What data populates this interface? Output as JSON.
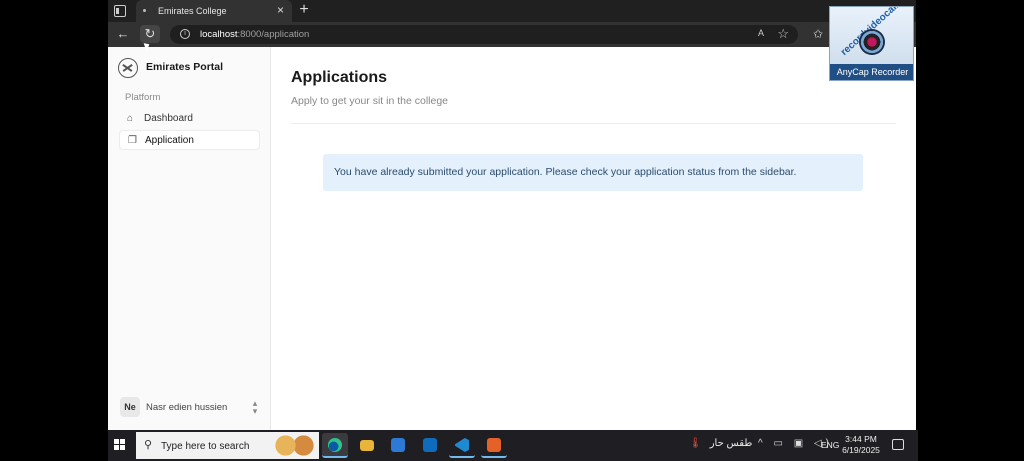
{
  "browser": {
    "tab_title": "Emirates College",
    "url_host": "localhost",
    "url_path": ":8000/application",
    "read_aloud": "A̅"
  },
  "sidebar": {
    "brand": "Emirates Portal",
    "group_label": "Platform",
    "items": [
      {
        "label": "Dashboard",
        "icon": "home-icon",
        "active": false
      },
      {
        "label": "Application",
        "icon": "document-stack-icon",
        "active": true
      }
    ],
    "user": {
      "initials": "Ne",
      "name": "Nasr edien hussien"
    }
  },
  "main": {
    "title": "Applications",
    "subtitle": "Apply to get your sit in the college",
    "alert": "You have already submitted your application. Please check your application status from the sidebar."
  },
  "recorder": {
    "site": "recordvideocall.com",
    "name": "AnyCap Recorder"
  },
  "taskbar": {
    "search_placeholder": "Type here to search",
    "weather": "طقس حار",
    "lang": "ENG",
    "time": "3:44 PM",
    "date": "6/19/2025"
  },
  "colors": {
    "alert_bg": "#e4f0fb",
    "alert_text": "#2b4c6f",
    "taskbar": "#1f1f23",
    "active_indicator": "#76b9ed"
  }
}
